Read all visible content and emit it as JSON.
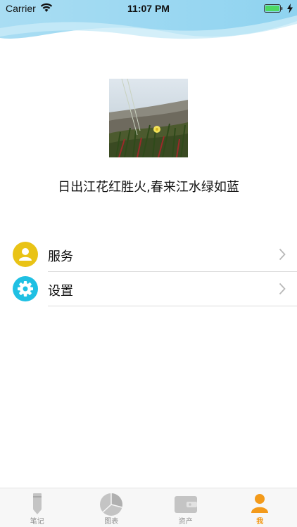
{
  "status_bar": {
    "carrier": "Carrier",
    "time": "11:07 PM"
  },
  "profile": {
    "motto": "日出江花红胜火,春来江水绿如蓝"
  },
  "menu": {
    "items": [
      {
        "label": "服务",
        "icon": "user-icon",
        "color": "#e9c316"
      },
      {
        "label": "设置",
        "icon": "gear-icon",
        "color": "#1fc0e3"
      }
    ]
  },
  "tabbar": {
    "tabs": [
      {
        "label": "笔记",
        "icon": "pencil-icon"
      },
      {
        "label": "图表",
        "icon": "pie-chart-icon"
      },
      {
        "label": "资产",
        "icon": "wallet-icon"
      },
      {
        "label": "我",
        "icon": "person-icon"
      }
    ],
    "active_color": "#f39a1a",
    "inactive_color": "#8e8e8e"
  }
}
